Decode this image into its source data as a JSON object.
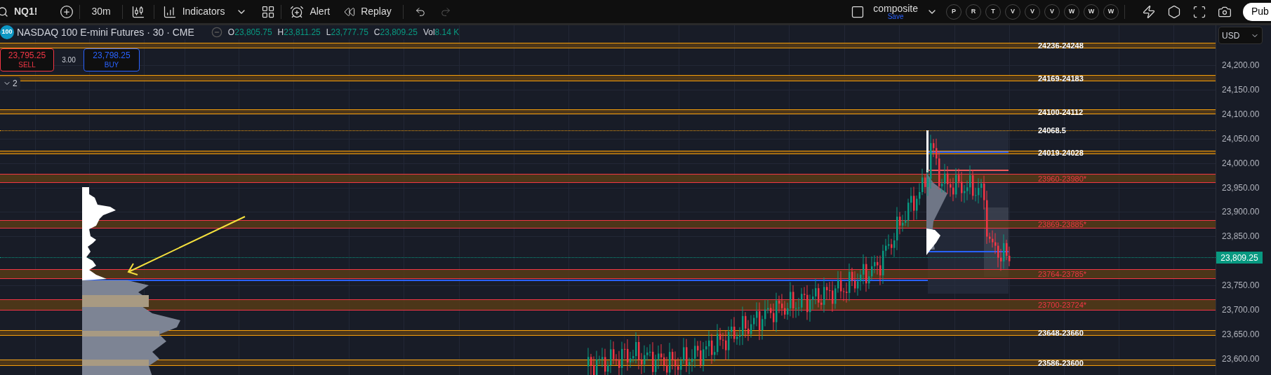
{
  "toolbar": {
    "symbol": "NQ1!",
    "interval": "30m",
    "indicators_label": "Indicators",
    "alert_label": "Alert",
    "replay_label": "Replay",
    "layout_name": "composite",
    "layout_status": "Save",
    "quick_buttons": [
      "P",
      "R",
      "T",
      "V",
      "V",
      "V",
      "W",
      "W",
      "W"
    ],
    "publish_label": "Pub"
  },
  "legend": {
    "logo": "100",
    "title": "NASDAQ 100 E-mini Futures · 30 · CME",
    "ohlc": [
      {
        "key": "O",
        "value": "23,805.75"
      },
      {
        "key": "H",
        "value": "23,811.25"
      },
      {
        "key": "L",
        "value": "23,777.75"
      },
      {
        "key": "C",
        "value": "23,809.25"
      },
      {
        "key": "Vol",
        "value": "8.14 K"
      }
    ]
  },
  "trade": {
    "sell_price": "23,795.25",
    "sell_label": "SELL",
    "spread": "3.00",
    "buy_price": "23,798.25",
    "buy_label": "BUY"
  },
  "indicator_group": {
    "count": "2"
  },
  "currency": "USD",
  "zones": [
    {
      "label": "24236-24248",
      "kind": "level"
    },
    {
      "label": "24169-24183",
      "kind": "level"
    },
    {
      "label": "24100-24112",
      "kind": "level"
    },
    {
      "label": "24068.5",
      "kind": "line"
    },
    {
      "label": "24019-24028",
      "kind": "level"
    },
    {
      "label": "23960-23980*",
      "kind": "reaction"
    },
    {
      "label": "23869-23885*",
      "kind": "reaction"
    },
    {
      "label": "23764-23785*",
      "kind": "reaction"
    },
    {
      "label": "23700-23724*",
      "kind": "reaction"
    },
    {
      "label": "23648-23660",
      "kind": "level"
    },
    {
      "label": "23586-23600",
      "kind": "level"
    }
  ],
  "price_axis": {
    "ticks": [
      "24,200.00",
      "24,150.00",
      "24,100.00",
      "24,050.00",
      "24,000.00",
      "23,950.00",
      "23,900.00",
      "23,850.00",
      "23,750.00",
      "23,700.00",
      "23,650.00",
      "23,600.00"
    ],
    "last_price": "23,809.25"
  }
}
